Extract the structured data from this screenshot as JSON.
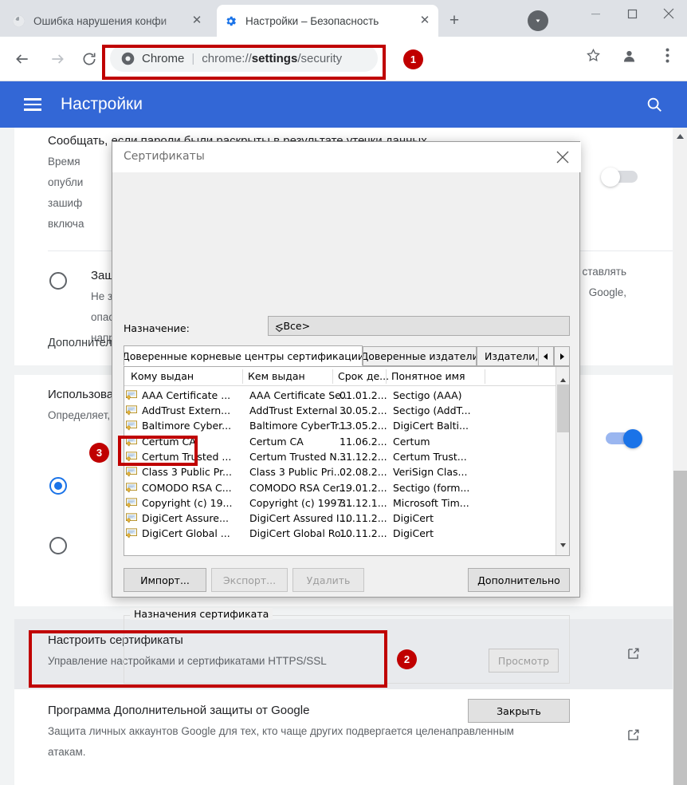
{
  "browser": {
    "tabs": [
      {
        "title": "Ошибка нарушения конфи",
        "favicon": "globe-icon",
        "active": false
      },
      {
        "title": "Настройки – Безопасность",
        "favicon": "gear-icon",
        "active": true
      }
    ],
    "new_tab_label": "+",
    "window_controls": {
      "minimize": "—",
      "maximize": "□",
      "close": "✕"
    },
    "omnibox": {
      "brand": "Chrome",
      "separator": "|",
      "url_prefix": "chrome://",
      "url_bold": "settings",
      "url_suffix": "/security",
      "full_url": "chrome://settings/security"
    }
  },
  "settings": {
    "header_title": "Настройки",
    "rows": {
      "breach_title": "Сообщать, если пароли были раскрыты в результате утечки данных",
      "secure_dns_lines": [
        "Время",
        "опубли",
        "зашиф",
        "включа"
      ],
      "protection_title": "Защита",
      "protection_lines": [
        "Не заш",
        "опасно",
        "наприм"
      ],
      "protection_right": [
        "ставлять",
        "Google,"
      ],
      "advanced_heading": "Дополнительн",
      "use_title": "Использоват",
      "use_sub": "Определяет,",
      "certificates_title": "Настроить сертификаты",
      "certificates_sub": "Управление настройками и сертификатами HTTPS/SSL",
      "advanced_protection_title": "Программа Дополнительной защиты от Google",
      "advanced_protection_sub_line1": "Защита личных аккаунтов Google для тех, кто чаще других подвергается целенаправленным",
      "advanced_protection_sub_line2": "атакам."
    }
  },
  "dialog": {
    "title": "Сертификаты",
    "close_icon": "close-icon",
    "purpose_label": "Назначение:",
    "purpose_value": "<Все>",
    "tabs": [
      {
        "label": "Доверенные корневые центры сертификации",
        "selected": true
      },
      {
        "label": "Доверенные издатели",
        "selected": false
      },
      {
        "label": "Издатели, не и",
        "selected": false
      }
    ],
    "tab_nav": {
      "prev": "◄",
      "next": "►"
    },
    "columns": [
      "Кому выдан",
      "Кем выдан",
      "Срок де...",
      "Понятное имя"
    ],
    "rows": [
      {
        "issued_to": "AAA Certificate ...",
        "issued_by": "AAA Certificate Se...",
        "expires": "01.01.2...",
        "friendly": "Sectigo (AAA)"
      },
      {
        "issued_to": "AddTrust Extern...",
        "issued_by": "AddTrust External ...",
        "expires": "30.05.2...",
        "friendly": "Sectigo (AddT..."
      },
      {
        "issued_to": "Baltimore Cyber...",
        "issued_by": "Baltimore CyberTr...",
        "expires": "13.05.2...",
        "friendly": "DigiCert Balti..."
      },
      {
        "issued_to": "Certum CA",
        "issued_by": "Certum CA",
        "expires": "11.06.2...",
        "friendly": "Certum"
      },
      {
        "issued_to": "Certum Trusted ...",
        "issued_by": "Certum Trusted N...",
        "expires": "31.12.2...",
        "friendly": "Certum Trust..."
      },
      {
        "issued_to": "Class 3 Public Pr...",
        "issued_by": "Class 3 Public Pri...",
        "expires": "02.08.2...",
        "friendly": "VeriSign Clas..."
      },
      {
        "issued_to": "COMODO RSA C...",
        "issued_by": "COMODO RSA Cer...",
        "expires": "19.01.2...",
        "friendly": "Sectigo (form..."
      },
      {
        "issued_to": "Copyright (c) 19...",
        "issued_by": "Copyright (c) 1997...",
        "expires": "31.12.1...",
        "friendly": "Microsoft Tim..."
      },
      {
        "issued_to": "DigiCert Assure...",
        "issued_by": "DigiCert Assured I...",
        "expires": "10.11.2...",
        "friendly": "DigiCert"
      },
      {
        "issued_to": "DigiCert Global ...",
        "issued_by": "DigiCert Global Ro...",
        "expires": "10.11.2...",
        "friendly": "DigiCert"
      }
    ],
    "buttons": {
      "import": "Импорт...",
      "export": "Экспорт...",
      "remove": "Удалить",
      "advanced": "Дополнительно",
      "view": "Просмотр",
      "close": "Закрыть"
    },
    "group_legend": "Назначения сертификата"
  },
  "annotations": [
    {
      "id": "1",
      "label": "1"
    },
    {
      "id": "2",
      "label": "2"
    },
    {
      "id": "3",
      "label": "3"
    }
  ],
  "colors": {
    "annotation_red": "#c00000",
    "settings_header_blue": "#3367d6",
    "accent_blue": "#1a73e8",
    "tabstrip_gray": "#dee1e6"
  }
}
